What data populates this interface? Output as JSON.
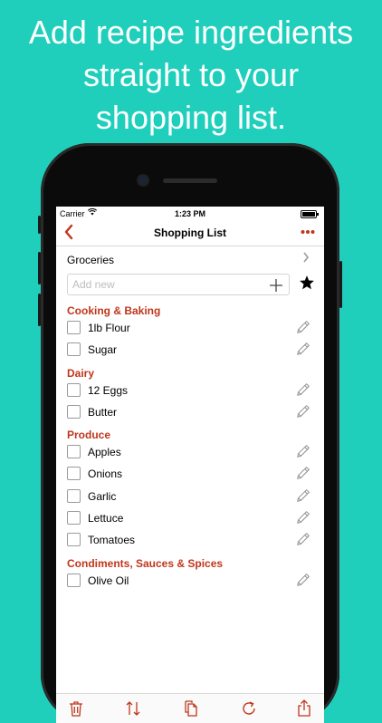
{
  "promo": {
    "headline": [
      "Add recipe ingredients",
      "straight to your",
      "shopping list."
    ]
  },
  "status": {
    "carrier": "Carrier",
    "time": "1:23 PM"
  },
  "nav": {
    "title": "Shopping List"
  },
  "list": {
    "name": "Groceries"
  },
  "add": {
    "placeholder": "Add new"
  },
  "sections": [
    {
      "title": "Cooking & Baking",
      "items": [
        "1lb Flour",
        "Sugar"
      ]
    },
    {
      "title": "Dairy",
      "items": [
        "12 Eggs",
        "Butter"
      ]
    },
    {
      "title": "Produce",
      "items": [
        "Apples",
        "Onions",
        "Garlic",
        "Lettuce",
        "Tomatoes"
      ]
    },
    {
      "title": "Condiments, Sauces & Spices",
      "items": [
        "Olive Oil"
      ]
    }
  ],
  "colors": {
    "background": "#1fcfbb",
    "accent": "#c0361b"
  },
  "icons": {
    "back": "chevron-left-icon",
    "more": "more-icon",
    "add": "plus-icon",
    "favorite": "star-icon",
    "edit": "pencil-icon",
    "delete": "trash-icon",
    "sort": "sort-icon",
    "copy": "copy-icon",
    "refresh": "refresh-icon",
    "share": "share-icon"
  }
}
